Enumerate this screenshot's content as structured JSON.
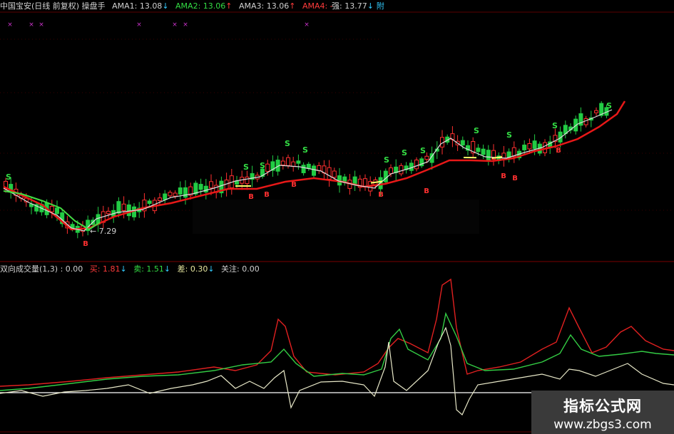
{
  "top_bar": {
    "title": "中国宝安(日线 前复权) 操盘手",
    "ama1": "AMA1: 13.08",
    "ama1_arrow": "↓",
    "ama2": "AMA2: 13.06",
    "ama2_arrow": "↑",
    "ama3": "AMA3: 13.06",
    "ama3_arrow": "↑",
    "ama4": "AMA4: -",
    "strong": "强: 13.77",
    "strong_arrow": "↓",
    "trailing": "附"
  },
  "main_chart": {
    "price_label": "7.29",
    "signals": {
      "sell": "S",
      "buy": "B"
    }
  },
  "bottom_bar": {
    "indicator": "双向成交量(1,3) : 0.00",
    "buy": "买: 1.81",
    "buy_arrow": "↓",
    "sell": "卖: 1.51",
    "sell_arrow": "↓",
    "diff": "差: 0.30",
    "diff_arrow": "↓",
    "focus": "关注: 0.00"
  },
  "watermark": {
    "line1": "指标公式网",
    "line2": "www.zbgs3.com"
  },
  "colors": {
    "bg": "#000000",
    "up": "#ff3030",
    "down": "#22cc44",
    "ama_red": "#e81818",
    "buy_line": "#e02020",
    "sell_line": "#33cc44",
    "diff_line": "#e8e8c8"
  }
}
